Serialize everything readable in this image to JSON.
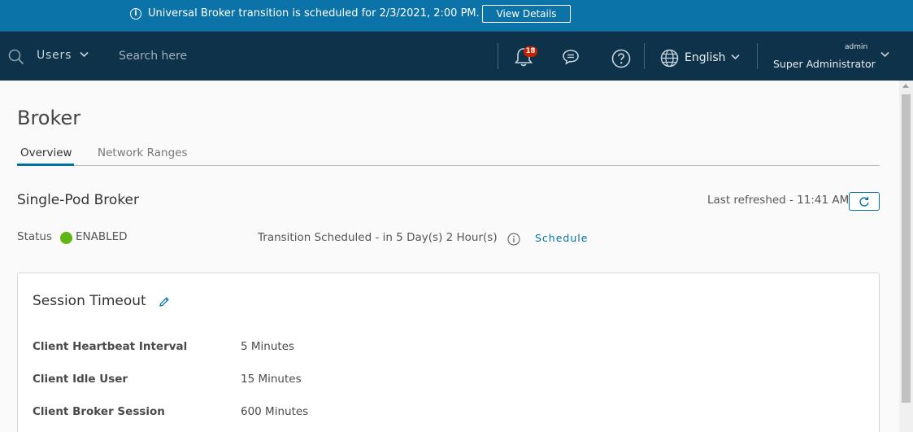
{
  "banner": {
    "message": "Universal Broker transition is scheduled for 2/3/2021, 2:00 PM.",
    "button_label": "View Details",
    "info_icon": "info-icon"
  },
  "topnav": {
    "scope_label": "Users",
    "search_placeholder": "Search here",
    "notification_count": "18",
    "language": "English",
    "user_role": "admin",
    "user_name": "Super Administrator",
    "colors": {
      "background": "#0d3249",
      "banner": "#0b73a8",
      "badge": "#c92100"
    }
  },
  "page": {
    "title": "Broker",
    "tabs": [
      {
        "label": "Overview",
        "active": true
      },
      {
        "label": "Network Ranges",
        "active": false
      }
    ],
    "section_title": "Single-Pod Broker",
    "last_refreshed": "Last refreshed - 11:41 AM",
    "status_label": "Status",
    "status_value": "ENABLED",
    "status_color": "#60b515",
    "transition_text": "Transition Scheduled - in 5 Day(s) 2 Hour(s)",
    "schedule_link": "Schedule"
  },
  "session_timeout": {
    "title": "Session Timeout",
    "rows": [
      {
        "key": "Client Heartbeat Interval",
        "value": "5 Minutes"
      },
      {
        "key": "Client Idle User",
        "value": "15 Minutes"
      },
      {
        "key": "Client Broker Session",
        "value": "600 Minutes"
      }
    ]
  }
}
